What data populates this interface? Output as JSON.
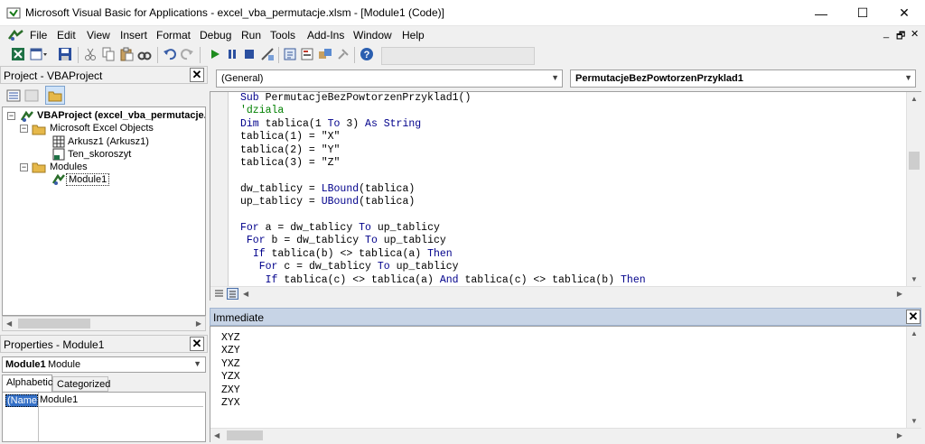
{
  "window": {
    "title": "Microsoft Visual Basic for Applications - excel_vba_permutacje.xlsm - [Module1 (Code)]",
    "minimize": "—",
    "maximize": "☐",
    "close": "✕"
  },
  "menu": {
    "items": [
      "File",
      "Edit",
      "View",
      "Insert",
      "Format",
      "Debug",
      "Run",
      "Tools",
      "Add-Ins",
      "Window",
      "Help"
    ],
    "mdi_minimize": "_",
    "mdi_restore": "🗗",
    "mdi_close": "✕"
  },
  "project_panel": {
    "title": "Project - VBAProject",
    "close": "✕",
    "tree": {
      "root": "VBAProject (excel_vba_permutacje.xlsm)",
      "folder_objects": "Microsoft Excel Objects",
      "sheet1": "Arkusz1 (Arkusz1)",
      "workbook": "Ten_skoroszyt",
      "folder_modules": "Modules",
      "module1": "Module1"
    }
  },
  "properties_panel": {
    "title": "Properties - Module1",
    "close": "✕",
    "combo_name": "Module1",
    "combo_type": "Module",
    "tabs": [
      "Alphabetic",
      "Categorized"
    ],
    "row_name": "(Name)",
    "row_value": "Module1"
  },
  "code_window": {
    "object_combo": "(General)",
    "proc_combo": "PermutacjeBezPowtorzenPrzyklad1",
    "lines": [
      [
        [
          "k",
          "Sub "
        ],
        [
          "t",
          "PermutacjeBezPowtorzenPrzyklad1()"
        ]
      ],
      [
        [
          "c",
          "'dziala"
        ]
      ],
      [
        [
          "k",
          "Dim "
        ],
        [
          "t",
          "tablica(1 "
        ],
        [
          "k",
          "To"
        ],
        [
          "t",
          " 3) "
        ],
        [
          "k",
          "As String"
        ]
      ],
      [
        [
          "t",
          "tablica(1) = \"X\""
        ]
      ],
      [
        [
          "t",
          "tablica(2) = \"Y\""
        ]
      ],
      [
        [
          "t",
          "tablica(3) = \"Z\""
        ]
      ],
      [
        [
          "t",
          ""
        ]
      ],
      [
        [
          "t",
          "dw_tablicy = "
        ],
        [
          "k",
          "LBound"
        ],
        [
          "t",
          "(tablica)"
        ]
      ],
      [
        [
          "t",
          "up_tablicy = "
        ],
        [
          "k",
          "UBound"
        ],
        [
          "t",
          "(tablica)"
        ]
      ],
      [
        [
          "t",
          ""
        ]
      ],
      [
        [
          "k",
          "For"
        ],
        [
          "t",
          " a = dw_tablicy "
        ],
        [
          "k",
          "To"
        ],
        [
          "t",
          " up_tablicy"
        ]
      ],
      [
        [
          "t",
          " "
        ],
        [
          "k",
          "For"
        ],
        [
          "t",
          " b = dw_tablicy "
        ],
        [
          "k",
          "To"
        ],
        [
          "t",
          " up_tablicy"
        ]
      ],
      [
        [
          "t",
          "  "
        ],
        [
          "k",
          "If"
        ],
        [
          "t",
          " tablica(b) <> tablica(a) "
        ],
        [
          "k",
          "Then"
        ]
      ],
      [
        [
          "t",
          "   "
        ],
        [
          "k",
          "For"
        ],
        [
          "t",
          " c = dw_tablicy "
        ],
        [
          "k",
          "To"
        ],
        [
          "t",
          " up_tablicy"
        ]
      ],
      [
        [
          "t",
          "    "
        ],
        [
          "k",
          "If"
        ],
        [
          "t",
          " tablica(c) <> tablica(a) "
        ],
        [
          "k",
          "And"
        ],
        [
          "t",
          " tablica(c) <> tablica(b) "
        ],
        [
          "k",
          "Then"
        ]
      ]
    ]
  },
  "immediate_window": {
    "title": "Immediate",
    "close": "✕",
    "lines": [
      "XYZ",
      "XZY",
      "YXZ",
      "YZX",
      "ZXY",
      "ZYX"
    ]
  },
  "colors": {
    "keyword": "#00008b",
    "comment": "#008000",
    "immediate_header": "#c7d4e6"
  }
}
